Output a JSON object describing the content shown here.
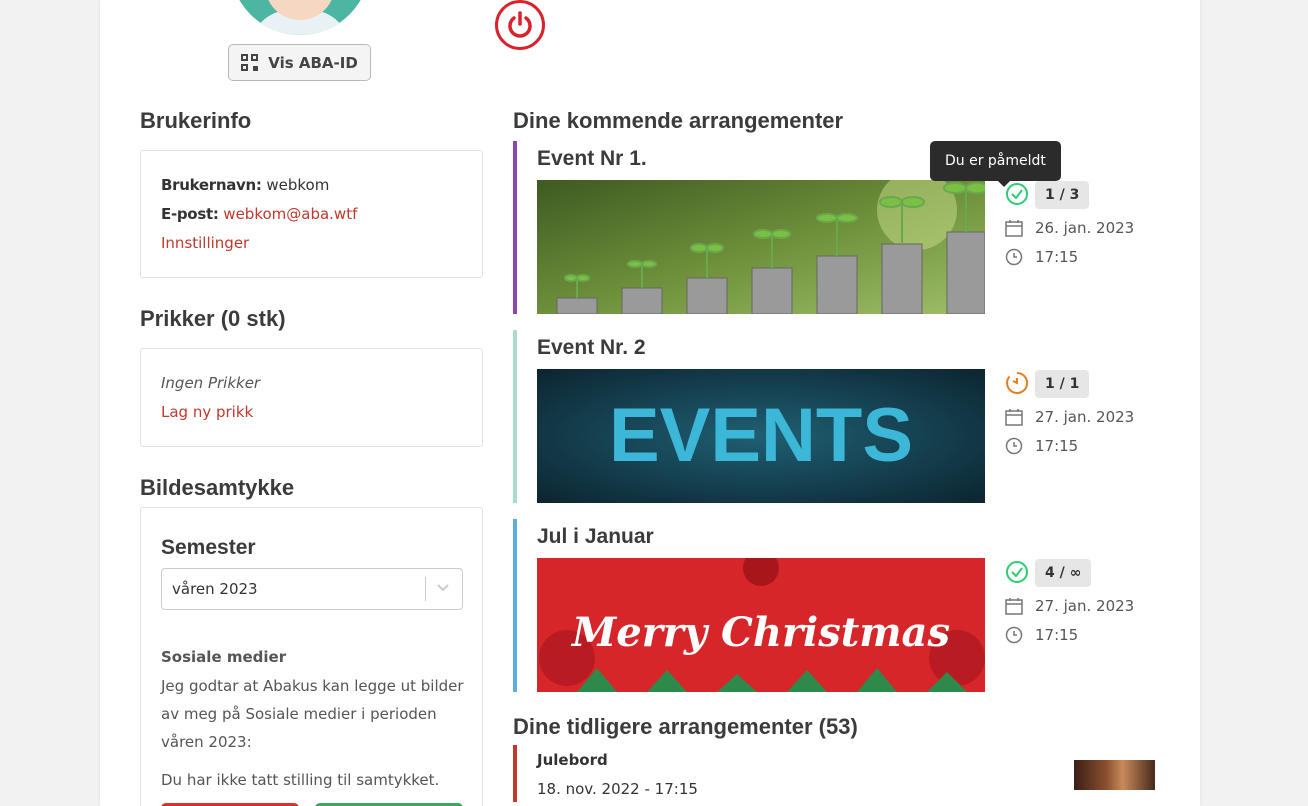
{
  "header": {
    "abaid_label": "Vis ABA-ID"
  },
  "userinfo": {
    "heading": "Brukerinfo",
    "username_label": "Brukernavn:",
    "username_value": "webkom",
    "email_label": "E-post:",
    "email_value": "webkom@aba.wtf",
    "settings_link": "Innstillinger"
  },
  "penalties": {
    "heading": "Prikker (0 stk)",
    "none_text": "Ingen Prikker",
    "new_link": "Lag ny prikk"
  },
  "photo_consent": {
    "heading": "Bildesamtykke",
    "semester_heading": "Semester",
    "semester_selected": "våren 2023",
    "social_heading": "Sosiale medier",
    "social_text": "Jeg godtar at Abakus kan legge ut bilder av meg på Sosiale medier i perioden våren 2023:",
    "status_text": "Du har ikke tatt stilling til samtykket."
  },
  "upcoming": {
    "heading": "Dine kommende arrangementer",
    "tooltip": "Du er påmeldt",
    "events": [
      {
        "title": "Event Nr 1.",
        "count": "1 / 3",
        "date": "26. jan. 2023",
        "time": "17:15",
        "status": "registered",
        "accent": "#8e44ad",
        "image": "plants-coins"
      },
      {
        "title": "Event Nr. 2",
        "count": "1 / 1",
        "date": "27. jan. 2023",
        "time": "17:15",
        "status": "waiting",
        "accent": "#a8dccf",
        "image": "events-banner"
      },
      {
        "title": "Jul i Januar",
        "count": "4 / ∞",
        "date": "27. jan. 2023",
        "time": "17:15",
        "status": "registered",
        "accent": "#5dade2",
        "image": "merry-christmas"
      }
    ],
    "banner_texts": {
      "events": "EVENTS",
      "christmas": "Merry Christmas"
    }
  },
  "past": {
    "heading": "Dine tidligere arrangementer (53)",
    "events": [
      {
        "title": "Julebord",
        "when": "18. nov. 2022 - 17:15"
      }
    ]
  },
  "colors": {
    "accent_red": "#c0392b",
    "power_red": "#d9222a",
    "ok_green": "#2ecc71",
    "wait_orange": "#e67e22"
  }
}
